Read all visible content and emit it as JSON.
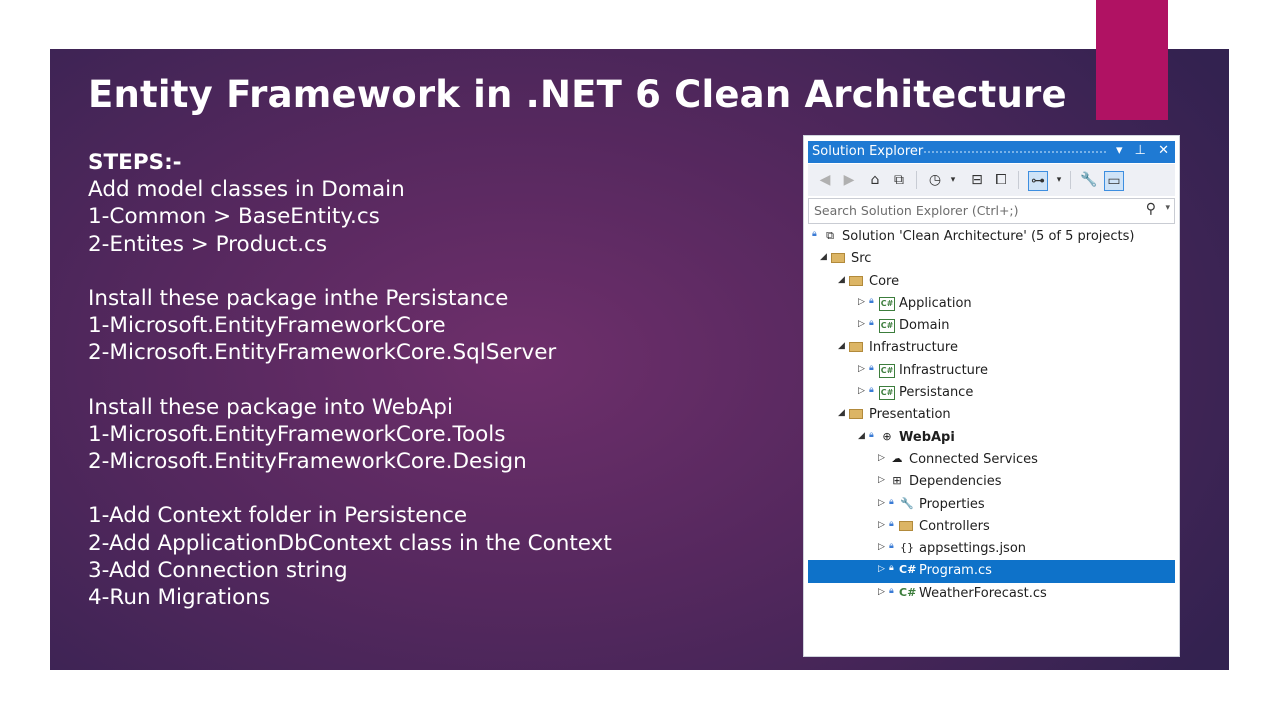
{
  "slide": {
    "title": "Entity Framework in .NET 6 Clean Architecture",
    "lines": [
      {
        "text": "STEPS:-",
        "bold": true
      },
      {
        "text": "Add model classes in Domain"
      },
      {
        "text": "1-Common > BaseEntity.cs"
      },
      {
        "text": "2-Entites > Product.cs"
      },
      {
        "text": ""
      },
      {
        "text": "Install these package inthe Persistance"
      },
      {
        "text": "1-Microsoft.EntityFrameworkCore"
      },
      {
        "text": "2-Microsoft.EntityFrameworkCore.SqlServer"
      },
      {
        "text": ""
      },
      {
        "text": "Install these package into WebApi"
      },
      {
        "text": "1-Microsoft.EntityFrameworkCore.Tools"
      },
      {
        "text": "2-Microsoft.EntityFrameworkCore.Design"
      },
      {
        "text": ""
      },
      {
        "text": "1-Add Context folder in Persistence"
      },
      {
        "text": "2-Add ApplicationDbContext class in the Context"
      },
      {
        "text": "3-Add Connection string"
      },
      {
        "text": "4-Run Migrations"
      }
    ],
    "colors": {
      "accent": "#b01263",
      "background": "#55285e",
      "text": "#ffffff"
    }
  },
  "solution_explorer": {
    "title": "Solution Explorer",
    "title_buttons": {
      "dropdown": "▾",
      "pin": "⊥",
      "close": "✕"
    },
    "search_placeholder": "Search Solution Explorer (Ctrl+;)",
    "colors": {
      "titlebar": "#1f7ad3",
      "selection": "#0e72c9"
    },
    "tree": [
      {
        "label": "Solution 'Clean Architecture' (5 of 5 projects)",
        "level": 0,
        "icon": "solution-icon",
        "lock": true,
        "expander": ""
      },
      {
        "label": "Src",
        "level": 1,
        "icon": "folder-icon",
        "expander": "◢"
      },
      {
        "label": "Core",
        "level": 2,
        "icon": "folder-icon",
        "expander": "◢"
      },
      {
        "label": "Application",
        "level": 3,
        "icon": "csharp-project-icon",
        "lock": true,
        "expander": "▷"
      },
      {
        "label": "Domain",
        "level": 3,
        "icon": "csharp-project-icon",
        "lock": true,
        "expander": "▷"
      },
      {
        "label": "Infrastructure",
        "level": 2,
        "icon": "folder-icon",
        "expander": "◢"
      },
      {
        "label": "Infrastructure",
        "level": 3,
        "icon": "csharp-project-icon",
        "lock": true,
        "expander": "▷"
      },
      {
        "label": "Persistance",
        "level": 3,
        "icon": "csharp-project-icon",
        "lock": true,
        "expander": "▷"
      },
      {
        "label": "Presentation",
        "level": 2,
        "icon": "folder-icon",
        "expander": "◢"
      },
      {
        "label": "WebApi",
        "level": 3,
        "icon": "web-project-icon",
        "lock": true,
        "expander": "◢",
        "bold": true
      },
      {
        "label": "Connected Services",
        "level": 4,
        "icon": "connected-services-icon",
        "expander": "▷"
      },
      {
        "label": "Dependencies",
        "level": 4,
        "icon": "dependencies-icon",
        "expander": "▷"
      },
      {
        "label": "Properties",
        "level": 4,
        "icon": "properties-icon",
        "lock": true,
        "expander": "▷"
      },
      {
        "label": "Controllers",
        "level": 4,
        "icon": "folder-icon",
        "lock": true,
        "expander": "▷"
      },
      {
        "label": "appsettings.json",
        "level": 4,
        "icon": "json-file-icon",
        "lock": true,
        "expander": "▷"
      },
      {
        "label": "Program.cs",
        "level": 4,
        "icon": "csharp-file-icon",
        "lock": true,
        "expander": "▷",
        "selected": true
      },
      {
        "label": "WeatherForecast.cs",
        "level": 4,
        "icon": "csharp-file-icon",
        "lock": true,
        "expander": "▷"
      }
    ]
  }
}
